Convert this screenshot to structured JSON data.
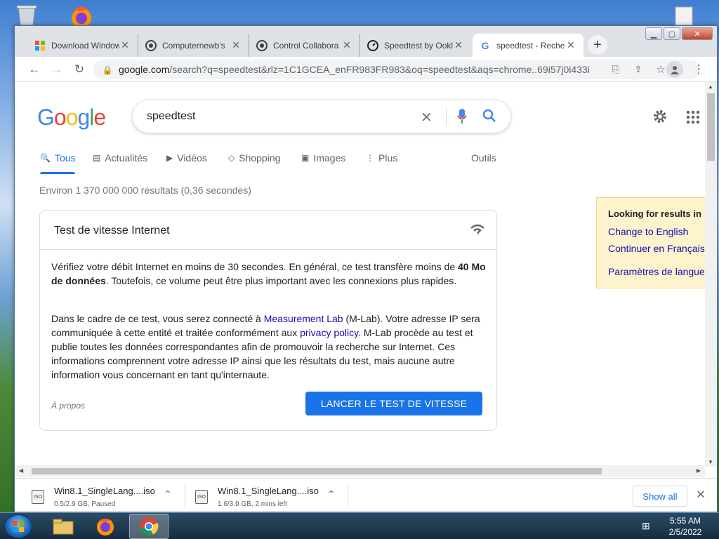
{
  "browser": {
    "tabs": [
      {
        "title": "Download Windows",
        "favicon": "microsoft-icon"
      },
      {
        "title": "Computernewb's",
        "favicon": "computernewb-icon"
      },
      {
        "title": "Control Collabora",
        "favicon": "computernewb-icon"
      },
      {
        "title": "Speedtest by Ookla",
        "favicon": "speedtest-icon"
      },
      {
        "title": "speedtest - Recherche",
        "favicon": "google-icon",
        "active": true
      }
    ],
    "url_domain": "google.com",
    "url_path": "/search?q=speedtest&rlz=1C1GCEA_enFR983FR983&oq=speedtest&aqs=chrome..69i57j0i433i..."
  },
  "google": {
    "logo_letters": [
      "G",
      "o",
      "o",
      "g",
      "l",
      "e"
    ],
    "query": "speedtest",
    "nav": [
      {
        "label": "Tous",
        "icon": "search-icon"
      },
      {
        "label": "Actualités",
        "icon": "news-icon"
      },
      {
        "label": "Vidéos",
        "icon": "video-icon"
      },
      {
        "label": "Shopping",
        "icon": "tag-icon"
      },
      {
        "label": "Images",
        "icon": "image-icon"
      },
      {
        "label": "Plus",
        "icon": "more-icon"
      },
      {
        "label": "Outils",
        "icon": ""
      }
    ],
    "stats": "Environ 1 370 000 000 résultats (0,36 secondes)"
  },
  "card": {
    "title": "Test de vitesse Internet",
    "p1_a": "Vérifiez votre débit Internet en moins de 30 secondes. En général, ce test transfère moins de ",
    "p1_b": "40 Mo de données",
    "p1_c": ". Toutefois, ce volume peut être plus important avec les connexions plus rapides.",
    "p2_a": "Dans le cadre de ce test, vous serez connecté à ",
    "p2_link1": "Measurement Lab",
    "p2_b": " (M-Lab). Votre adresse IP sera communiquée à cette entité et traitée conformément aux ",
    "p2_link2": "privacy policy",
    "p2_c": ". M-Lab procède au test et publie toutes les données correspondantes afin de promouvoir la recherche sur Internet. Ces informations comprennent votre adresse IP ainsi que les résultats du test, mais aucune autre information vous concernant en tant qu'internaute.",
    "about": "À propos",
    "button": "LANCER LE TEST DE VITESSE"
  },
  "lang_box": {
    "heading": "Looking for results in",
    "link1": "Change to English",
    "link2": "Continuer en Français",
    "link3": "Paramètres de langue"
  },
  "downloads": [
    {
      "name": "Win8.1_SingleLang....iso",
      "status": "0.5/2.9 GB, Paused",
      "icon_label": "ISO"
    },
    {
      "name": "Win8.1_SingleLang....iso",
      "status": "1.6/3.9 GB, 2 mins left",
      "icon_label": "ISO"
    }
  ],
  "downloads_show_all": "Show all",
  "taskbar": {
    "time": "5:55 AM",
    "date": "2/5/2022"
  }
}
